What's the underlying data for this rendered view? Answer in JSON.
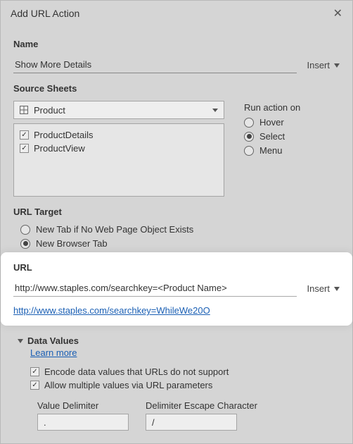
{
  "title": "Add URL Action",
  "name_section": {
    "label": "Name",
    "value": "Show More Details",
    "insert": "Insert"
  },
  "source": {
    "label": "Source Sheets",
    "dropdown": "Product",
    "sheets": [
      {
        "label": "ProductDetails",
        "checked": true
      },
      {
        "label": "ProductView",
        "checked": true
      }
    ]
  },
  "run_action": {
    "label": "Run action on",
    "options": [
      {
        "label": "Hover",
        "checked": false
      },
      {
        "label": "Select",
        "checked": true
      },
      {
        "label": "Menu",
        "checked": false
      }
    ]
  },
  "url_target": {
    "label": "URL Target",
    "options": [
      {
        "label": "New Tab if No Web Page Object Exists",
        "checked": false
      },
      {
        "label": "New Browser Tab",
        "checked": true
      }
    ]
  },
  "url_section": {
    "label": "URL",
    "value": "http://www.staples.com/searchkey=<Product Name>",
    "insert": "Insert",
    "preview": "http://www.staples.com/searchkey=WhileWe20O"
  },
  "data_values": {
    "label": "Data Values",
    "learn_more": "Learn more",
    "encode": {
      "label": "Encode data values that URLs do not support",
      "checked": true
    },
    "allow_multiple": {
      "label": "Allow multiple values via URL parameters",
      "checked": true
    },
    "value_delimiter_label": "Value Delimiter",
    "value_delimiter": ".",
    "escape_label": "Delimiter Escape Character",
    "escape": "/"
  }
}
